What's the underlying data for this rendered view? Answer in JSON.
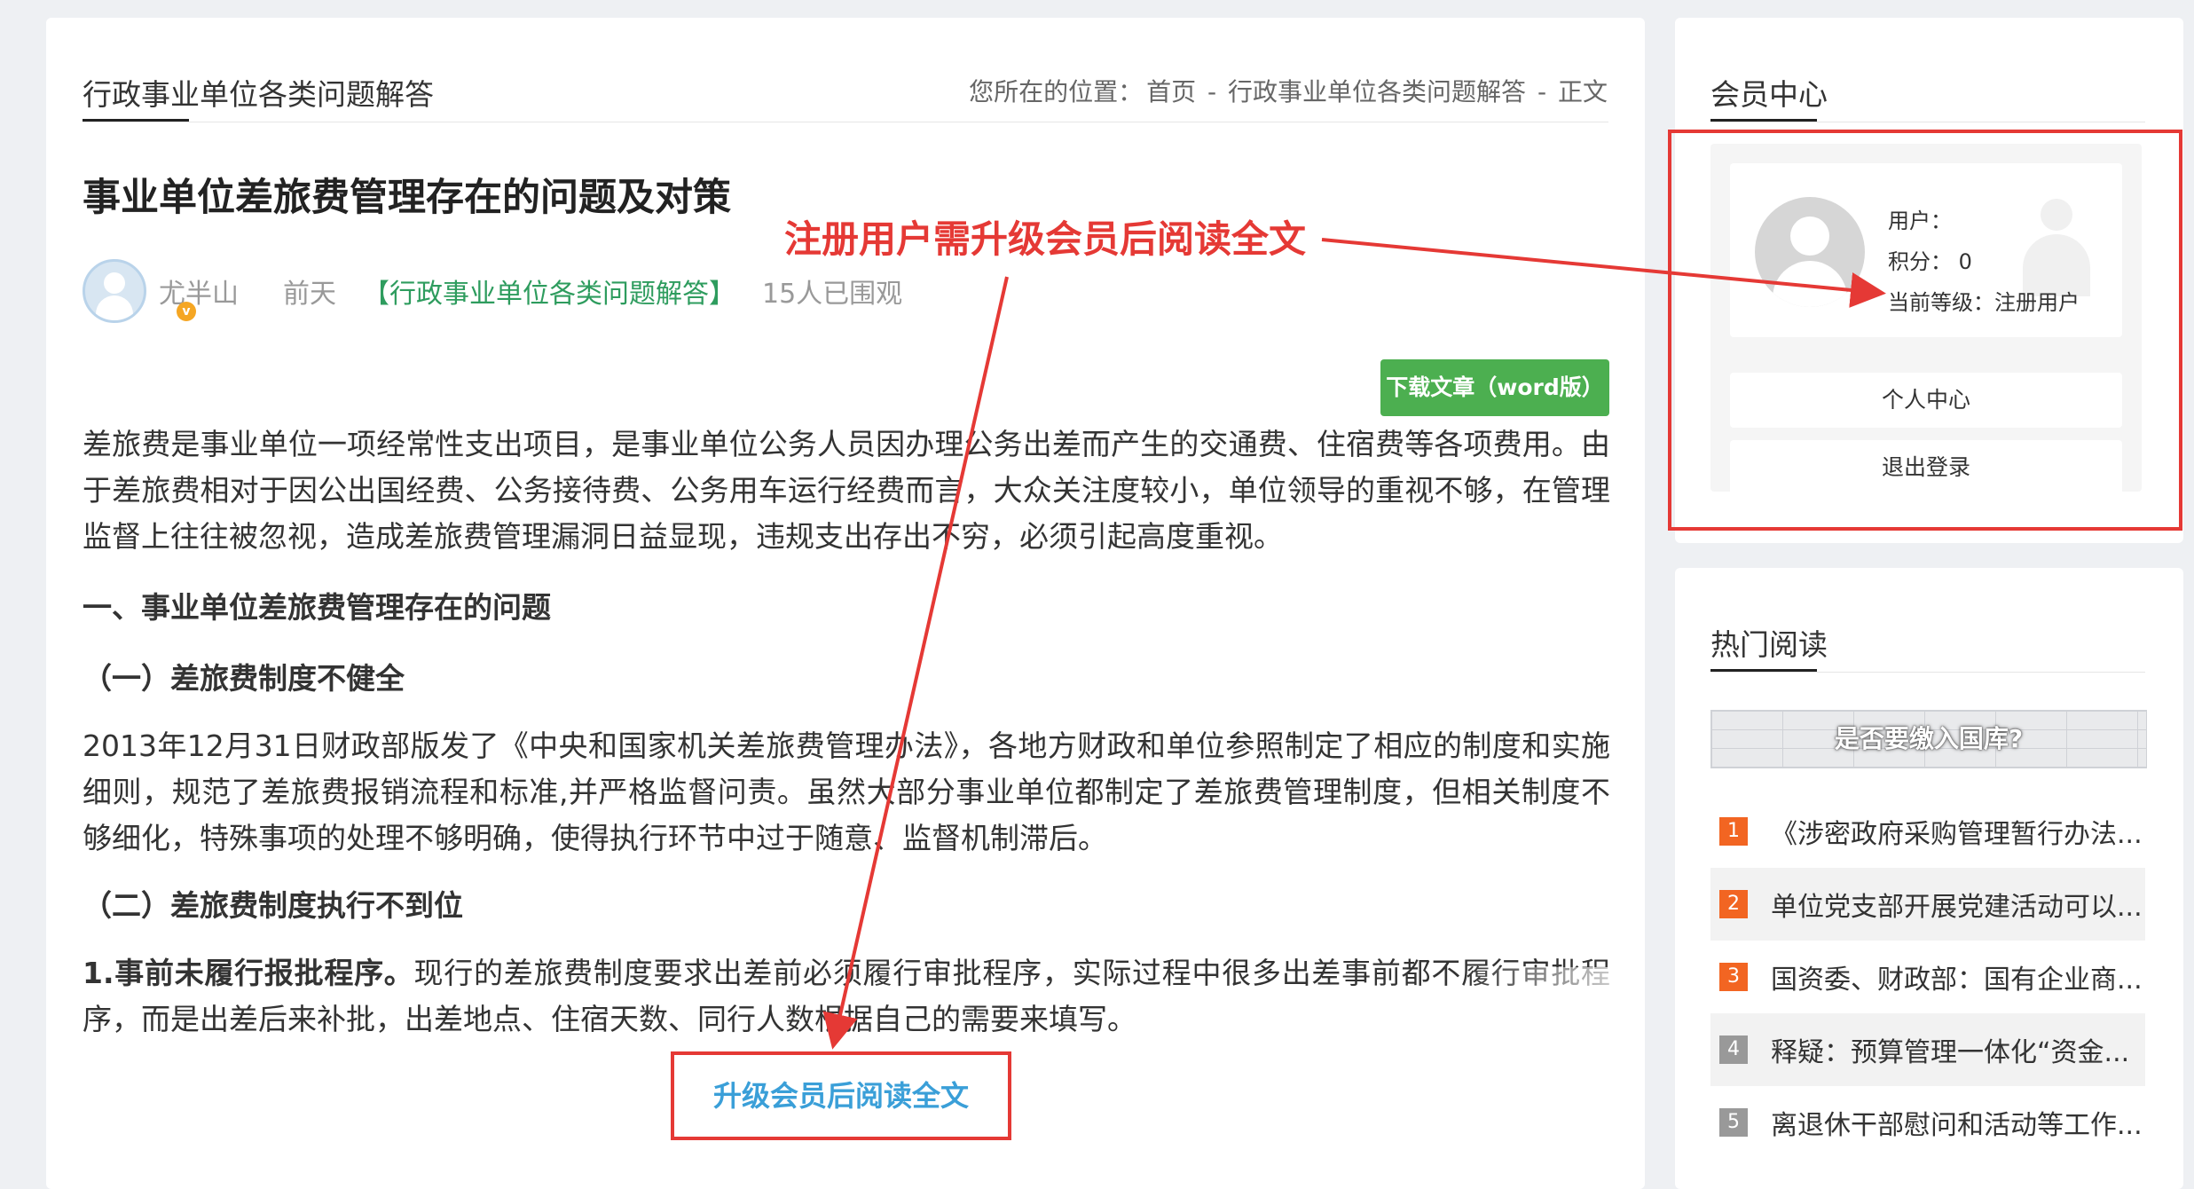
{
  "header": {
    "category_title": "行政事业单位各类问题解答",
    "breadcrumb_label": "您所在的位置：",
    "breadcrumb": [
      "首页",
      "行政事业单位各类问题解答",
      "正文"
    ],
    "breadcrumb_sep": "-"
  },
  "article": {
    "title": "事业单位差旅费管理存在的问题及对策",
    "author": "尤半山",
    "time": "前天",
    "category": "【行政事业单位各类问题解答】",
    "views": "15人已围观",
    "download_label": "下载文章（word版）",
    "p1": "差旅费是事业单位一项经常性支出项目，是事业单位公务人员因办理公务出差而产生的交通费、住宿费等各项费用。由于差旅费相对于因公出国经费、公务接待费、公务用车运行经费而言，大众关注度较小，单位领导的重视不够，在管理监督上往往被忽视，造成差旅费管理漏洞日益显现，违规支出存出不穷，必须引起高度重视。",
    "h1": "一、事业单位差旅费管理存在的问题",
    "h1_1": "（一）差旅费制度不健全",
    "p2": "2013年12月31日财政部版发了《中央和国家机关差旅费管理办法》，各地方财政和单位参照制定了相应的制度和实施细则，规范了差旅费报销流程和标准,并严格监督问责。虽然大部分事业单位都制定了差旅费管理制度，但相关制度不够细化，特殊事项的处理不够明确，使得执行环节中过于随意、监督机制滞后。",
    "h1_2": "（二）差旅费制度执行不到位",
    "p3_bold": "1.事前未履行报批程序。",
    "p3": "现行的差旅费制度要求出差前必须履行审批程序，实际过程中很多出差事前都不履行审批程序，而是出差后来补批，出差地点、住宿天数、同行人数根据自己的需要来填写。",
    "upgrade_label": "升级会员后阅读全文"
  },
  "annotation": {
    "text": "注册用户需升级会员后阅读全文"
  },
  "member": {
    "title": "会员中心",
    "user_label": "用户：",
    "points_label": "积分：",
    "points_value": "0",
    "level_label": "当前等级：",
    "level_value": "注册用户",
    "btn_profile": "个人中心",
    "btn_logout": "退出登录"
  },
  "hot": {
    "title": "热门阅读",
    "image_caption": "是否要缴入国库?",
    "items": [
      {
        "num": "1",
        "text": "《涉密政府采购管理暂行办法..."
      },
      {
        "num": "2",
        "text": "单位党支部开展党建活动可以..."
      },
      {
        "num": "3",
        "text": "国资委、财政部：国有企业商..."
      },
      {
        "num": "4",
        "text": "释疑：预算管理一体化“资金..."
      },
      {
        "num": "5",
        "text": "离退休干部慰问和活动等工作..."
      }
    ]
  },
  "colors": {
    "accent_green": "#4caf50",
    "category_green": "#2e9c5e",
    "annotation_red": "#e53935",
    "upgrade_blue": "#3a9fd8",
    "rank_orange": "#f26522"
  }
}
